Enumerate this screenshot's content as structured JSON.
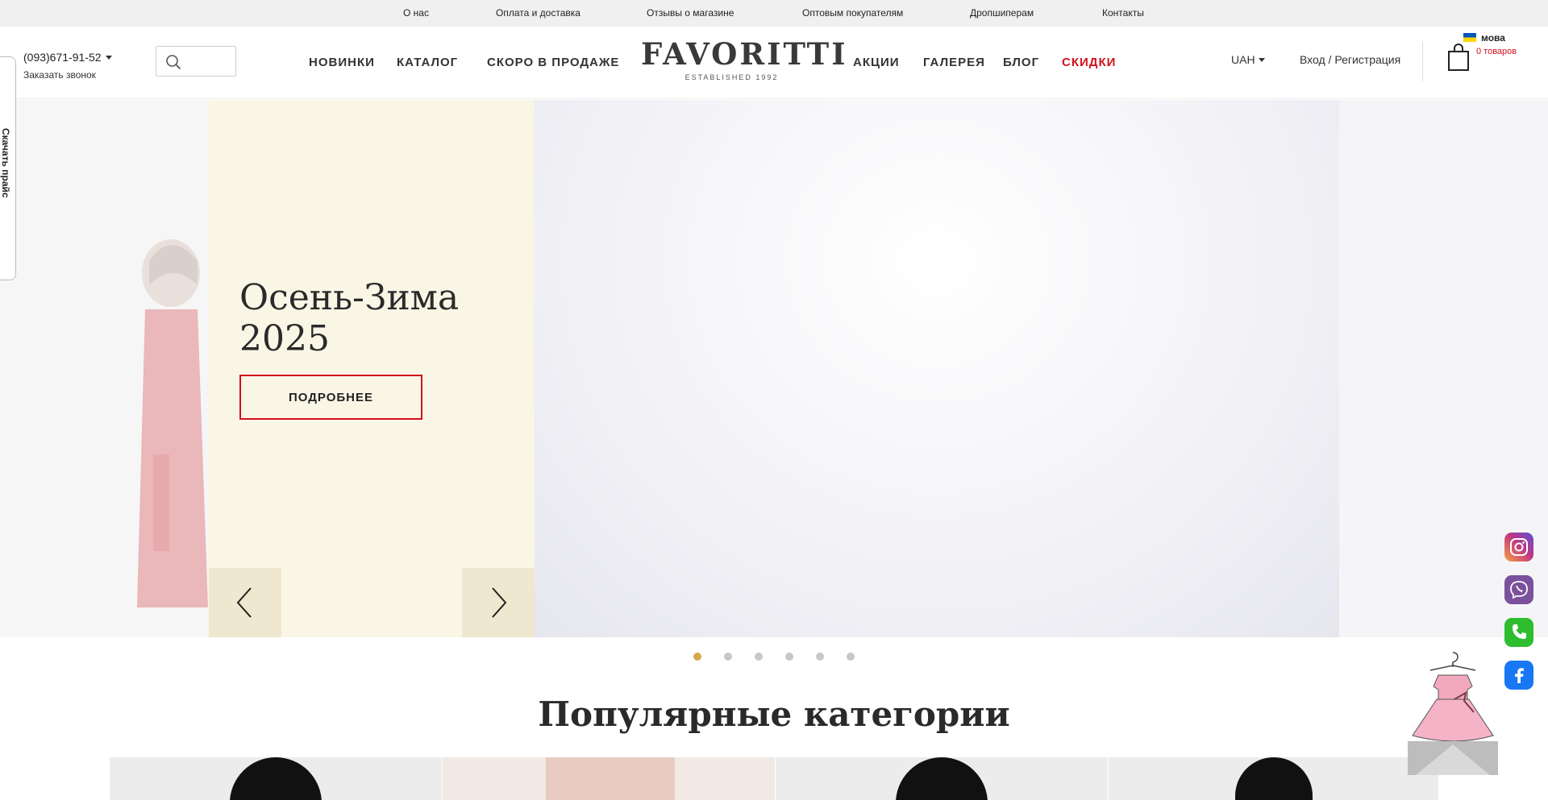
{
  "topbar": {
    "links": [
      "О нас",
      "Оплата и доставка",
      "Отзывы о магазине",
      "Оптовым покупателям",
      "Дропшиперам",
      "Контакты"
    ]
  },
  "header": {
    "phone": "(093)671-91-52",
    "callback": "Заказать звонок",
    "nav_left": [
      "НОВИНКИ",
      "КАТАЛОГ",
      "СКОРО В ПРОДАЖЕ"
    ],
    "nav_right": [
      "АКЦИИ",
      "ГАЛЕРЕЯ",
      "БЛОГ",
      "СКИДКИ"
    ],
    "logo_name": "FAVORITTI",
    "logo_tagline": "ESTABLISHED 1992",
    "currency": "UAH",
    "login": "Вход / Регистрация",
    "language": "мова",
    "cart_count": "0 товаров"
  },
  "side_tab": "Скачать прайс",
  "hero": {
    "title_line1": "Осень-Зима",
    "title_line2": "2025",
    "button": "ПОДРОБНЕЕ",
    "active_slide": 1,
    "slide_count": 6
  },
  "popular": {
    "title": "Популярные категории"
  },
  "social": [
    "instagram-icon",
    "viber-icon",
    "phone-icon",
    "facebook-icon"
  ],
  "colors": {
    "accent_red": "#d0101a",
    "cream": "#faf6e6",
    "dot_active": "#d4a84b",
    "instagram": "#c13584",
    "viber": "#7b519d",
    "phone": "#2ebd2e",
    "facebook": "#1877f2"
  }
}
